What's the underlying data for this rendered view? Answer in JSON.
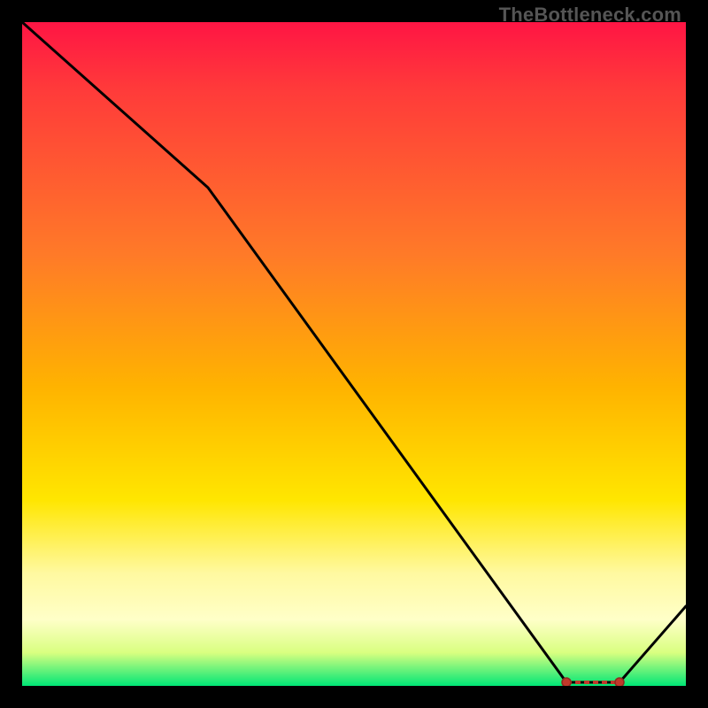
{
  "watermark": "TheBottleneck.com",
  "chart_data": {
    "type": "line",
    "title": "",
    "xlabel": "",
    "ylabel": "",
    "xlim": [
      0,
      100
    ],
    "ylim": [
      0,
      100
    ],
    "x": [
      0,
      28,
      82,
      90,
      100
    ],
    "values": [
      100,
      75,
      0,
      0,
      12
    ],
    "flat_segment_x": [
      82,
      90
    ],
    "flat_segment_label": ""
  },
  "colors": {
    "line": "#000000",
    "marker_fill": "#c0392b",
    "marker_stroke": "#8e2b20",
    "label_text": "#8e2b20"
  }
}
